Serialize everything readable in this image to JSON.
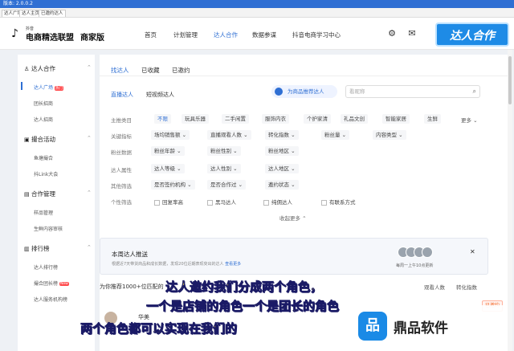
{
  "window": {
    "title": "版本: 2.0.0.2",
    "tabs": [
      "达人广场",
      "达人主页",
      "已邀约达人"
    ]
  },
  "header": {
    "logo_small": "抖音",
    "logo_name": "电商精选联盟",
    "logo_edition": "商家版",
    "nav": [
      "首页",
      "计划管理",
      "达人合作",
      "数据参谋",
      "抖音电商学习中心"
    ],
    "badge": "达人合作"
  },
  "sidebar": {
    "groups": [
      {
        "label": "达人合作",
        "icon": "user-icon",
        "items": [
          "达人广场",
          "团长招商",
          "达人招商"
        ]
      },
      {
        "label": "撮合活动",
        "icon": "activity-icon",
        "items": [
          "鱼塘撮合",
          "抖Link大会"
        ]
      },
      {
        "label": "合作管理",
        "icon": "manage-icon",
        "items": [
          "样品管理",
          "生鲜内容审核"
        ]
      },
      {
        "label": "排行榜",
        "icon": "rank-icon",
        "items": [
          "达人排行榜",
          "撮合团长榜",
          "达人服务机构榜"
        ]
      }
    ],
    "hot_label": "热门",
    "new_label": "New"
  },
  "main": {
    "tabs": [
      "找达人",
      "已收藏",
      "已邀约"
    ],
    "subtabs": [
      "直播达人",
      "短视频达人"
    ],
    "recommend_label": "为商品推荐达人",
    "search_placeholder": "看昵称",
    "filters": {
      "row1_label": "主推类目",
      "row1_chips": [
        "不限",
        "玩具乐器",
        "二手闲置",
        "服饰内衣",
        "个护家清",
        "礼品文创",
        "智能家居",
        "生鲜"
      ],
      "more_label": "更多",
      "row2_label": "关键指标",
      "row2_chips": [
        "场均销售额",
        "直播观看人数",
        "转化指数",
        "粉丝量",
        "内容类型"
      ],
      "row3_label": "粉丝数据",
      "row3_chips": [
        "粉丝年龄",
        "粉丝性别",
        "粉丝地区"
      ],
      "row4_label": "达人属性",
      "row4_chips": [
        "达人等级",
        "达人性别",
        "达人地区"
      ],
      "row5_label": "其他筛选",
      "row5_chips": [
        "是否签约机构",
        "是否合作过",
        "邀约状态"
      ],
      "row6_label": "个性筛选",
      "row6_checks": [
        "回复率高",
        "黑马达人",
        "纯佣达人",
        "有联系方式"
      ],
      "collapse_label": "收起更多"
    },
    "banner": {
      "title": "本周达人推送",
      "desc": "根据近7天带货商品和成长数据，发现20位近期表现突出的达人",
      "link": "查看更多",
      "count_text": "每周一上午10点更新"
    },
    "results_text": "为你推荐1000+位匹配的",
    "sort_labels": [
      "观看人数",
      "转化指数"
    ],
    "card_name": "华美",
    "edge_button": "已邀约"
  },
  "subtitles": [
    "达人邀约我们分成两个角色，",
    "一个是店铺的角色一个是团长的角色",
    "两个角色都可以实现在我们的"
  ],
  "watermark": "鼎品软件"
}
